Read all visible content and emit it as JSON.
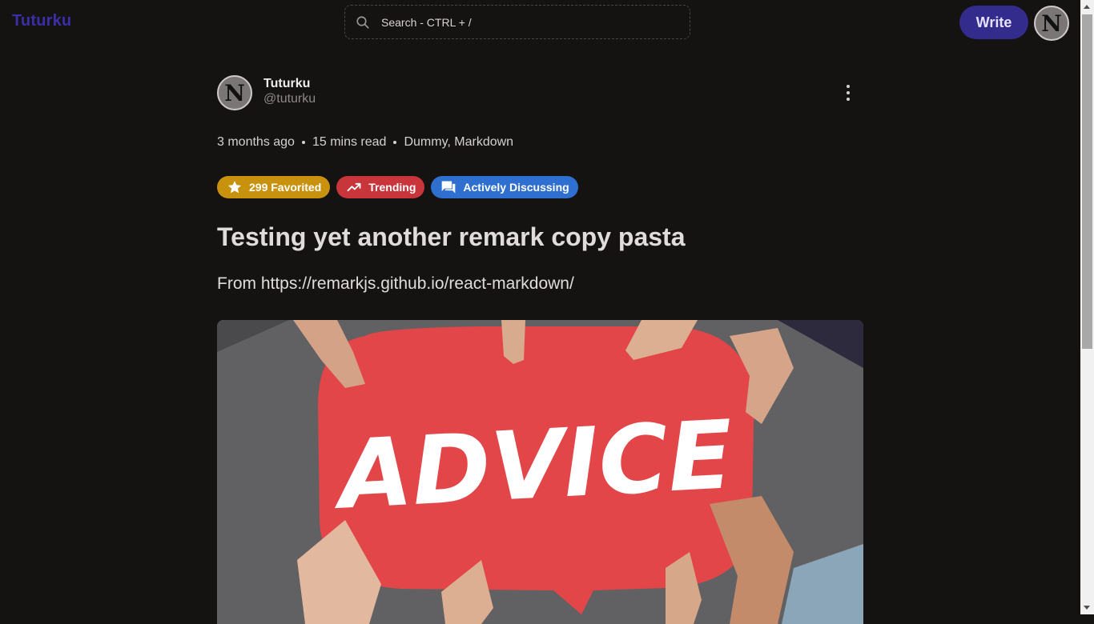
{
  "app": {
    "brand": "Tuturku"
  },
  "search": {
    "placeholder": "Search - CTRL + /"
  },
  "header": {
    "write_label": "Write",
    "avatar_initial": "N"
  },
  "author": {
    "initial": "N",
    "name": "Tuturku",
    "handle": "@tuturku"
  },
  "meta": {
    "posted": "3 months ago",
    "read_time": "15 mins read",
    "tags": "Dummy, Markdown"
  },
  "badges": {
    "favorited": "299 Favorited",
    "trending": "Trending",
    "discussing": "Actively Discussing"
  },
  "post": {
    "title": "Testing yet another remark copy pasta",
    "subtitle": "From https://remarkjs.github.io/react-markdown/",
    "image_text": "ADVICE"
  },
  "colors": {
    "brand": "#3b2fa8",
    "write_button": "#342c8c",
    "favorited": "#c9920e",
    "trending": "#c8353a",
    "discussing": "#2f6fd0",
    "bubble": "#e24648"
  },
  "icons": {
    "search": "search-icon",
    "more": "more-vertical-icon",
    "star": "star-icon",
    "trending": "trending-up-icon",
    "discussing": "forum-icon"
  }
}
